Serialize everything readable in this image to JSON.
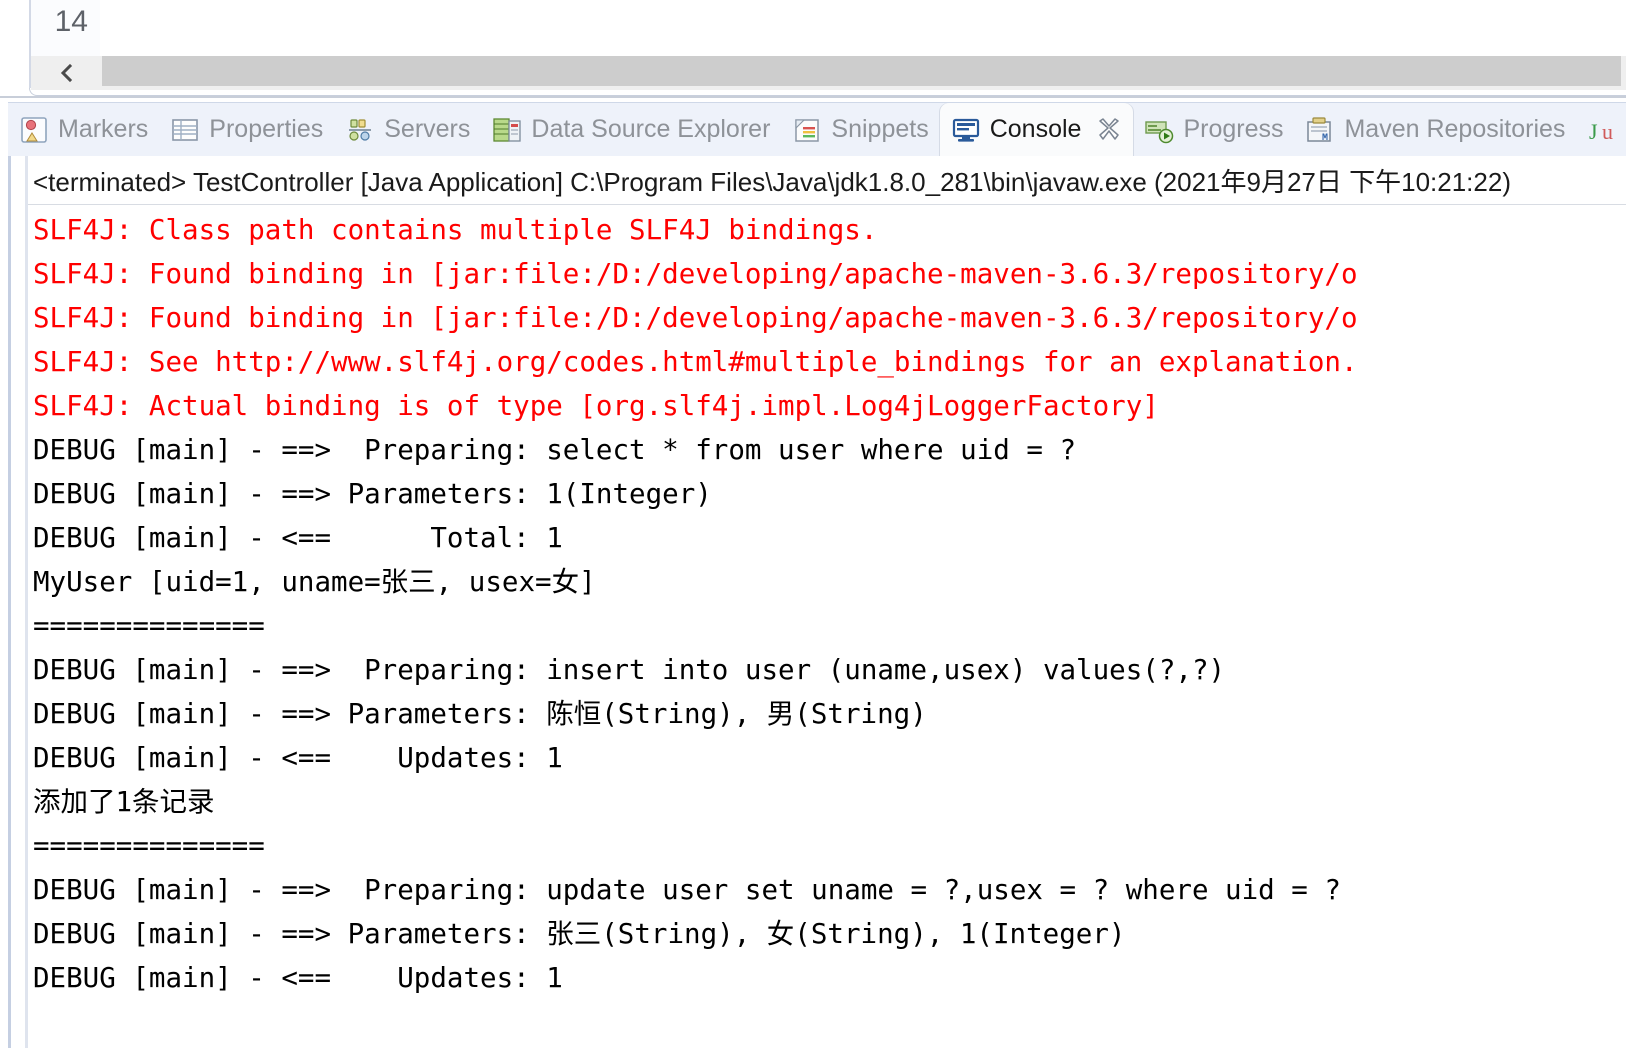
{
  "editor": {
    "line_number": "14",
    "hscroll": {
      "left_arrow_icon": "chevron-left-icon"
    }
  },
  "tabs": [
    {
      "label": "Markers",
      "icon": "markers-icon",
      "active": false,
      "closable": false
    },
    {
      "label": "Properties",
      "icon": "properties-icon",
      "active": false,
      "closable": false
    },
    {
      "label": "Servers",
      "icon": "servers-icon",
      "active": false,
      "closable": false
    },
    {
      "label": "Data Source Explorer",
      "icon": "data-source-icon",
      "active": false,
      "closable": false
    },
    {
      "label": "Snippets",
      "icon": "snippets-icon",
      "active": false,
      "closable": false
    },
    {
      "label": "Console",
      "icon": "console-icon",
      "active": true,
      "closable": true
    },
    {
      "label": "Progress",
      "icon": "progress-icon",
      "active": false,
      "closable": false
    },
    {
      "label": "Maven Repositories",
      "icon": "maven-icon",
      "active": false,
      "closable": false
    },
    {
      "label": "Ju",
      "icon": "junit-icon",
      "active": false,
      "closable": false
    }
  ],
  "console": {
    "header": "<terminated> TestController [Java Application] C:\\Program Files\\Java\\jdk1.8.0_281\\bin\\javaw.exe (2021年9月27日 下午10:21:22)",
    "colors": {
      "error_text": "#ff0000",
      "normal_text": "#000000",
      "tab_active_bg": "#fafbfc",
      "tab_bar_bg": "#eef2fa",
      "scrollbar_thumb": "#cdcdcd"
    },
    "lines": [
      {
        "text": "SLF4J: Class path contains multiple SLF4J bindings.",
        "level": "error"
      },
      {
        "text": "SLF4J: Found binding in [jar:file:/D:/developing/apache-maven-3.6.3/repository/o",
        "level": "error"
      },
      {
        "text": "SLF4J: Found binding in [jar:file:/D:/developing/apache-maven-3.6.3/repository/o",
        "level": "error"
      },
      {
        "text": "SLF4J: See http://www.slf4j.org/codes.html#multiple_bindings for an explanation.",
        "level": "error"
      },
      {
        "text": "SLF4J: Actual binding is of type [org.slf4j.impl.Log4jLoggerFactory]",
        "level": "error"
      },
      {
        "text": "DEBUG [main] - ==>  Preparing: select * from user where uid = ?",
        "level": "normal"
      },
      {
        "text": "DEBUG [main] - ==> Parameters: 1(Integer)",
        "level": "normal"
      },
      {
        "text": "DEBUG [main] - <==      Total: 1",
        "level": "normal"
      },
      {
        "text": "MyUser [uid=1, uname=张三, usex=女]",
        "level": "normal"
      },
      {
        "text": "==============",
        "level": "normal"
      },
      {
        "text": "DEBUG [main] - ==>  Preparing: insert into user (uname,usex) values(?,?)",
        "level": "normal"
      },
      {
        "text": "DEBUG [main] - ==> Parameters: 陈恒(String), 男(String)",
        "level": "normal"
      },
      {
        "text": "DEBUG [main] - <==    Updates: 1",
        "level": "normal"
      },
      {
        "text": "添加了1条记录",
        "level": "normal"
      },
      {
        "text": "==============",
        "level": "normal"
      },
      {
        "text": "DEBUG [main] - ==>  Preparing: update user set uname = ?,usex = ? where uid = ?",
        "level": "normal"
      },
      {
        "text": "DEBUG [main] - ==> Parameters: 张三(String), 女(String), 1(Integer)",
        "level": "normal"
      },
      {
        "text": "DEBUG [main] - <==    Updates: 1",
        "level": "normal"
      }
    ]
  }
}
